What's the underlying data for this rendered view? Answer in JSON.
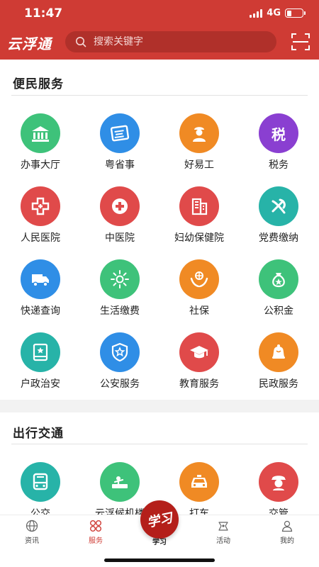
{
  "status_bar": {
    "time": "11:47",
    "network": "4G",
    "battery_level": 0.3
  },
  "app_bar": {
    "title": "云浮通",
    "search_placeholder": "搜索关键字",
    "scan_icon": "scan-icon"
  },
  "colors": {
    "brand": "#cf3b34",
    "green": "#3ec27a",
    "blue": "#2f8ee6",
    "orange": "#f08a24",
    "purple": "#8a3fd1",
    "red": "#e04a4a",
    "teal": "#27b3a8"
  },
  "sections": [
    {
      "title": "便民服务",
      "items": [
        {
          "label": "办事大厅",
          "icon": "government-hall-icon"
        },
        {
          "label": "粤省事",
          "icon": "yueshengshi-icon"
        },
        {
          "label": "好易工",
          "icon": "worker-icon"
        },
        {
          "label": "税务",
          "icon": "tax-icon",
          "glyph": "税"
        },
        {
          "label": "人民医院",
          "icon": "hospital-cross-icon"
        },
        {
          "label": "中医院",
          "icon": "medical-cross-icon"
        },
        {
          "label": "妇幼保健院",
          "icon": "hospital-building-icon"
        },
        {
          "label": "党费缴纳",
          "icon": "party-emblem-icon"
        },
        {
          "label": "快递查询",
          "icon": "delivery-truck-icon"
        },
        {
          "label": "生活缴费",
          "icon": "sun-icon"
        },
        {
          "label": "社保",
          "icon": "hands-globe-icon"
        },
        {
          "label": "公积金",
          "icon": "money-bag-icon"
        },
        {
          "label": "户政治安",
          "icon": "id-bookmark-icon"
        },
        {
          "label": "公安服务",
          "icon": "police-shield-icon"
        },
        {
          "label": "教育服务",
          "icon": "graduation-cap-icon"
        },
        {
          "label": "民政服务",
          "icon": "bell-icon"
        }
      ]
    },
    {
      "title": "出行交通",
      "items": [
        {
          "label": "公交",
          "icon": "bus-icon"
        },
        {
          "label": "云浮候机楼",
          "icon": "airport-icon"
        },
        {
          "label": "打车",
          "icon": "taxi-icon"
        },
        {
          "label": "交管",
          "icon": "traffic-police-icon"
        }
      ]
    }
  ],
  "bottom_nav": [
    {
      "label": "资讯",
      "icon": "globe-icon",
      "active": false
    },
    {
      "label": "服务",
      "icon": "services-icon",
      "active": true
    },
    {
      "label": "学习",
      "icon": "study-icon",
      "active": false,
      "badge_text": "学习"
    },
    {
      "label": "活动",
      "icon": "activity-icon",
      "active": false
    },
    {
      "label": "我的",
      "icon": "user-icon",
      "active": false
    }
  ]
}
